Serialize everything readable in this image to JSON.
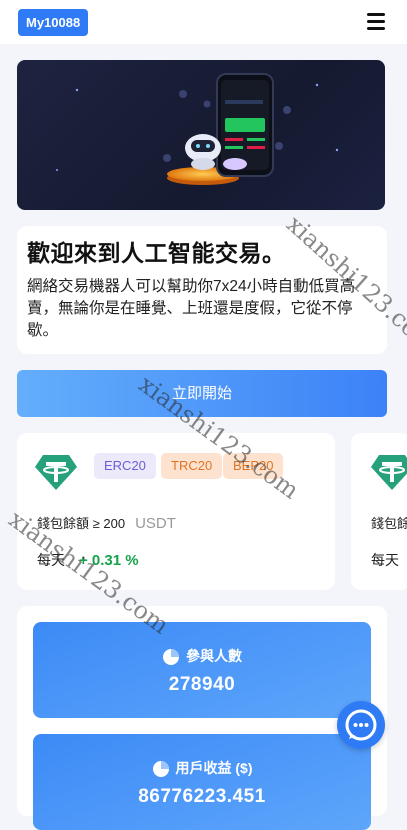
{
  "header": {
    "logo": "My10088",
    "menu_icon": "hamburger-menu-icon"
  },
  "hero": {
    "image": "trading-robot-phone-illustration"
  },
  "welcome": {
    "title": "歡迎來到人工智能交易。",
    "text": "網絡交易機器人可以幫助你7x24小時自動低買高賣，無論你是在睡覺、上班還是度假，它從不停歇。"
  },
  "start_button": {
    "label": "立即開始"
  },
  "coin_cards": [
    {
      "icon": "tether-icon",
      "tags": [
        "ERC20",
        "TRC20",
        "BEP20"
      ],
      "balance_label": "錢包餘額 ≥ 200",
      "unit": "USDT",
      "daily_label": "每天",
      "daily_value": "+ 0.31 %"
    },
    {
      "icon": "tether-icon",
      "balance_label": "錢包餘",
      "daily_label": "每天"
    }
  ],
  "stats": [
    {
      "label": "參與人數",
      "value": "278940",
      "icon": "pie-chart-icon"
    },
    {
      "label": "用戶收益 ($)",
      "value": "86776223.451",
      "icon": "pie-chart-icon"
    }
  ],
  "chat": {
    "icon": "chat-bubble-icon"
  },
  "watermark": "xianshi123.com",
  "colors": {
    "brand": "#2f7bf6",
    "tether": "#26a17b",
    "positive": "#16a34a"
  }
}
